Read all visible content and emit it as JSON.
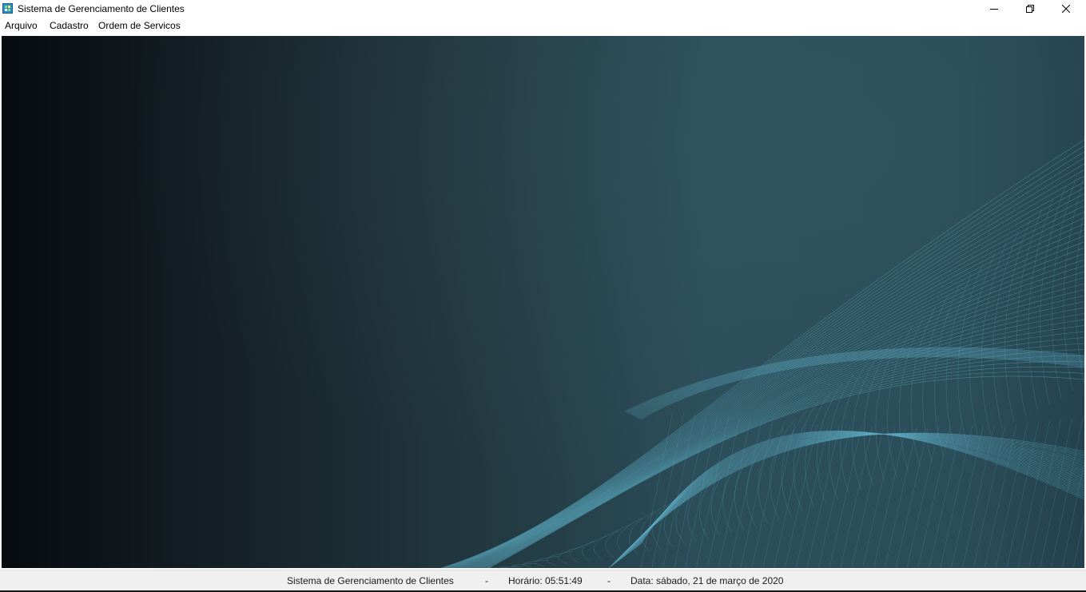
{
  "window": {
    "title": "Sistema de Gerenciamento de Clientes",
    "icon": "app-grid-icon",
    "controls": {
      "minimize": "minimize-icon",
      "maximize": "restore-icon",
      "close": "close-icon"
    }
  },
  "menu": {
    "items": [
      {
        "label": "Arquivo"
      },
      {
        "label": "Cadastro"
      },
      {
        "label": "Ordem de Servicos"
      }
    ]
  },
  "background": {
    "gradient_start": "#070b0f",
    "gradient_end": "#2c4e5a",
    "mesh_color": "#5fb0c8"
  },
  "status": {
    "app_name": "Sistema de Gerenciamento de Clientes",
    "separator": "-",
    "time": "Horário: 05:51:49",
    "date": "Data: sábado, 21 de março de 2020"
  }
}
